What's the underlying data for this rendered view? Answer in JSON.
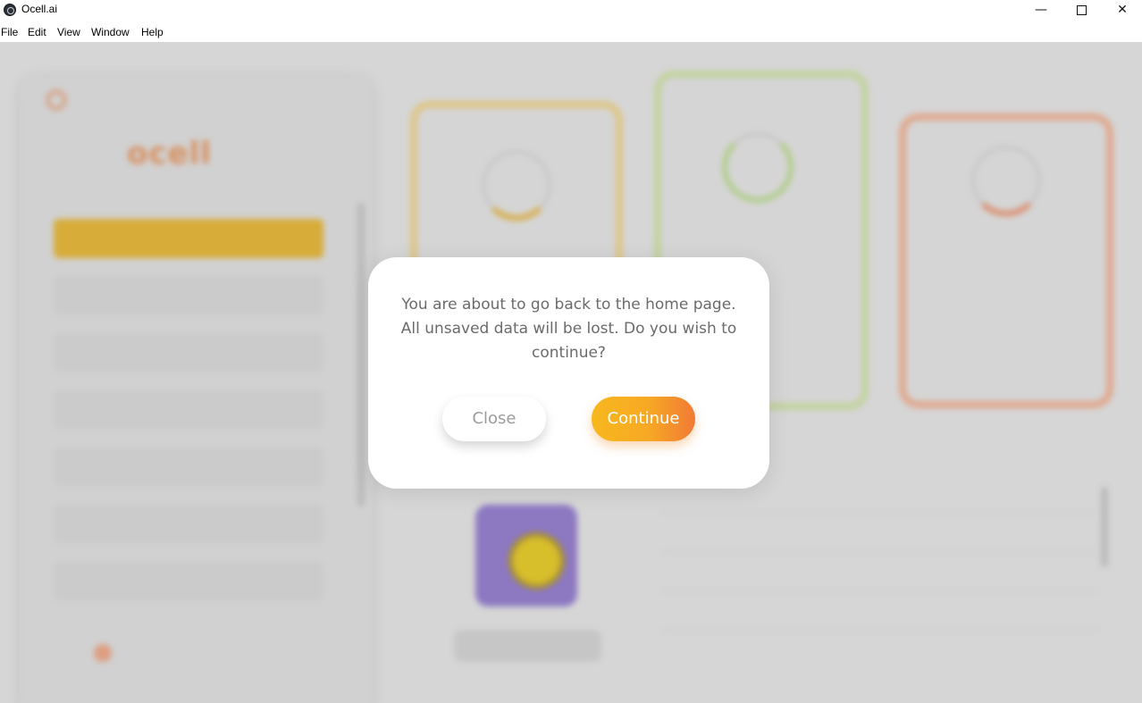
{
  "window": {
    "title": "Ocell.ai",
    "minimize_glyph": "—",
    "close_glyph": "✕"
  },
  "menu": {
    "items": [
      "File",
      "Edit",
      "View",
      "Window",
      "Help"
    ]
  },
  "dialog": {
    "message": "You are about to go back to the home page. All unsaved data will be lost. Do you wish to continue?",
    "close_label": "Close",
    "continue_label": "Continue"
  },
  "colors": {
    "accent_start": "#f7b81e",
    "accent_end": "#f17a35",
    "text_muted": "#6b6b6b"
  }
}
